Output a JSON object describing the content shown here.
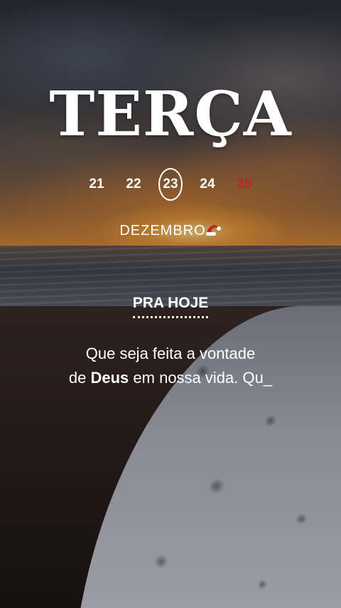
{
  "day": "TERÇA",
  "calendar": {
    "dates": [
      {
        "label": "21",
        "state": "normal"
      },
      {
        "label": "22",
        "state": "normal"
      },
      {
        "label": "23",
        "state": "selected"
      },
      {
        "label": "24",
        "state": "normal"
      },
      {
        "label": "25",
        "state": "holiday"
      }
    ],
    "month": "DEZEMBRO",
    "holiday_color": "#c4231f"
  },
  "section": {
    "label": "PRA HOJE"
  },
  "quote": {
    "line1": "Que seja feita a vontade",
    "line2_prefix": "de ",
    "line2_bold": "Deus",
    "line2_suffix": " em nossa vida. Qu_"
  },
  "icons": {
    "month_decoration": "santa-hat-icon"
  }
}
